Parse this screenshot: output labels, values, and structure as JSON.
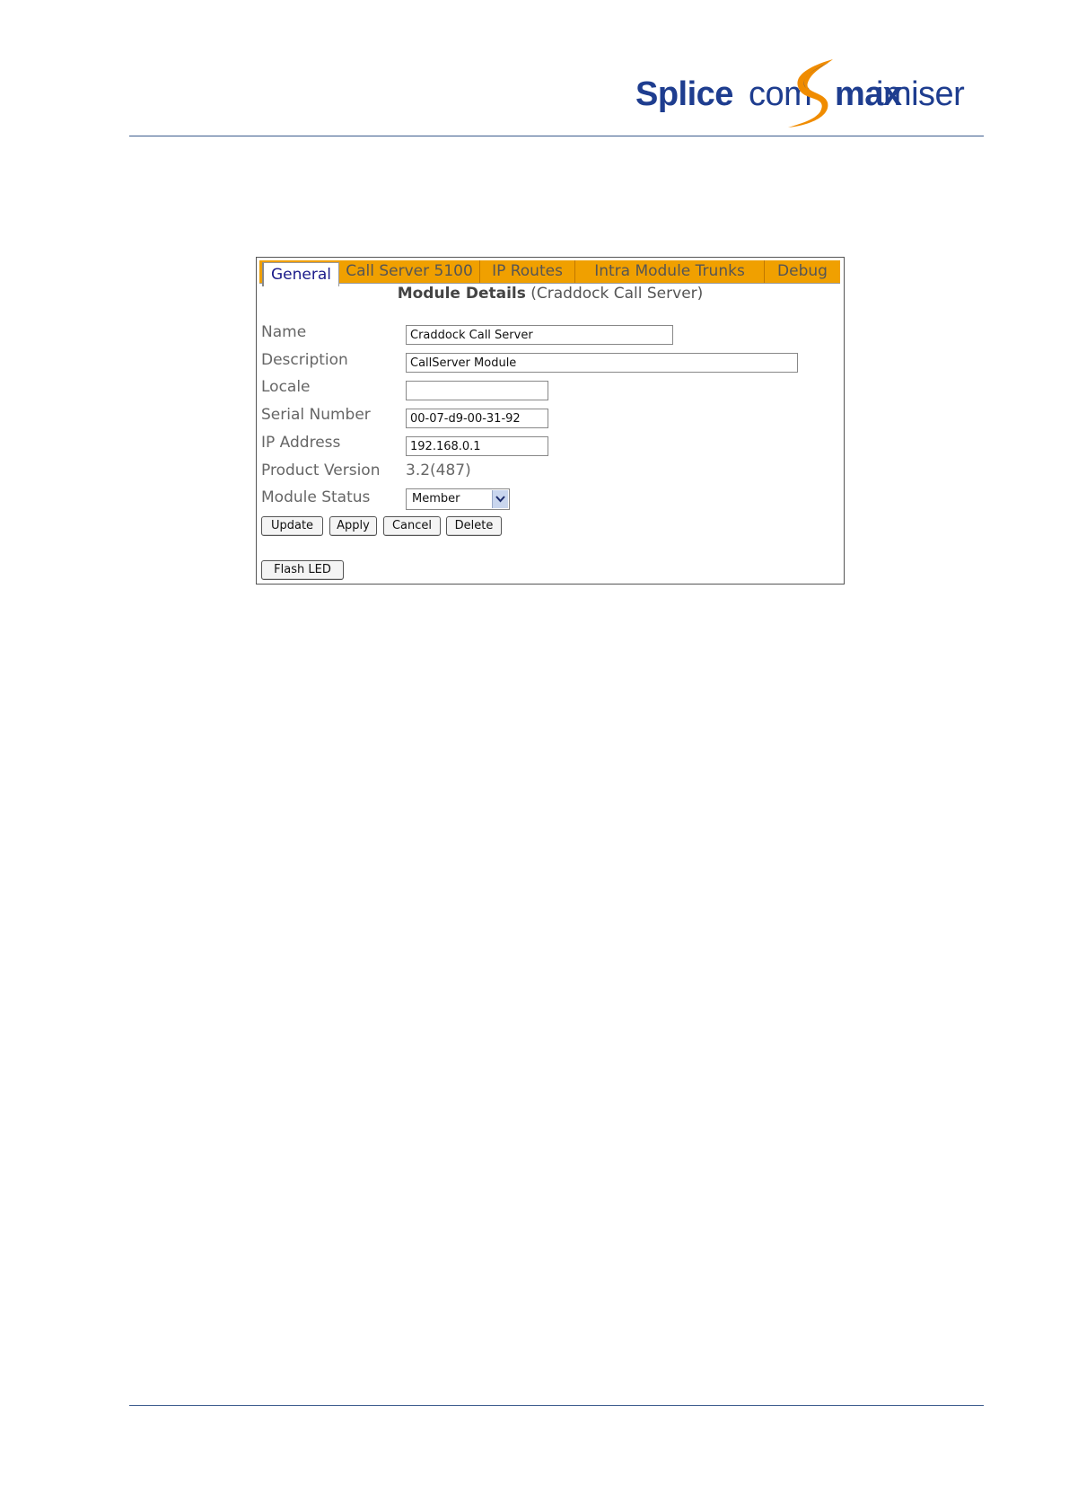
{
  "brand": {
    "part1": "Splice",
    "part2": "com",
    "part3": "max",
    "part4": "imiser",
    "primary_color": "#1e3d8f",
    "accent_color": "#f08c00"
  },
  "tabs": [
    {
      "label": "General",
      "active": true
    },
    {
      "label": "Call Server 5100",
      "active": false
    },
    {
      "label": "IP Routes",
      "active": false
    },
    {
      "label": "Intra Module Trunks",
      "active": false
    },
    {
      "label": "Debug",
      "active": false
    }
  ],
  "heading": {
    "bold": "Module Details",
    "sub": "(Craddock Call Server)"
  },
  "form": {
    "name_label": "Name",
    "name_value": "Craddock Call Server",
    "description_label": "Description",
    "description_value": "CallServer Module",
    "locale_label": "Locale",
    "locale_value": "",
    "serial_label": "Serial Number",
    "serial_value": "00-07-d9-00-31-92",
    "ip_label": "IP Address",
    "ip_value": "192.168.0.1",
    "version_label": "Product Version",
    "version_value": "3.2(487)",
    "status_label": "Module Status",
    "status_value": "Member"
  },
  "buttons": {
    "update": "Update",
    "apply": "Apply",
    "cancel": "Cancel",
    "delete": "Delete",
    "flash_led": "Flash LED"
  }
}
